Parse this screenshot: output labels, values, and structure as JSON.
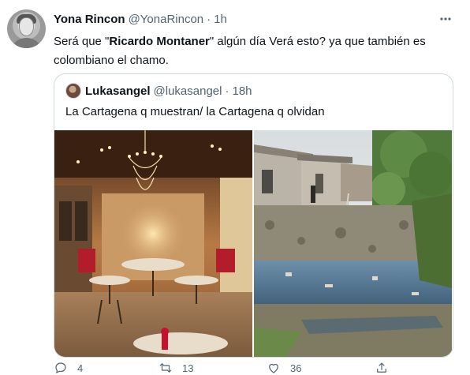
{
  "tweet": {
    "author_name": "Yona Rincon",
    "author_handle": "@YonaRincon",
    "separator": "·",
    "time": "1h",
    "avatar_icon": "avatar-icon",
    "text_part1": "Será que \"",
    "text_bold": "Ricardo Montaner",
    "text_part2": "\" algún día Verá esto? ya que también es colombiano el chamo.",
    "more_icon": "more-icon"
  },
  "quote": {
    "author_name": "Lukasangel",
    "author_handle": "@lukasangel",
    "separator": "·",
    "time": "18h",
    "text": "La Cartagena q muestran/ la Cartagena q olvidan",
    "media": [
      {
        "name": "restaurant-photo"
      },
      {
        "name": "slum-photo"
      }
    ]
  },
  "actions": {
    "reply_count": "4",
    "retweet_count": "13",
    "like_count": "36",
    "reply_icon": "reply-icon",
    "retweet_icon": "retweet-icon",
    "like_icon": "heart-icon",
    "share_icon": "share-icon"
  },
  "colors": {
    "text": "#0f1419",
    "secondary": "#536471",
    "border": "#cfd9de"
  }
}
